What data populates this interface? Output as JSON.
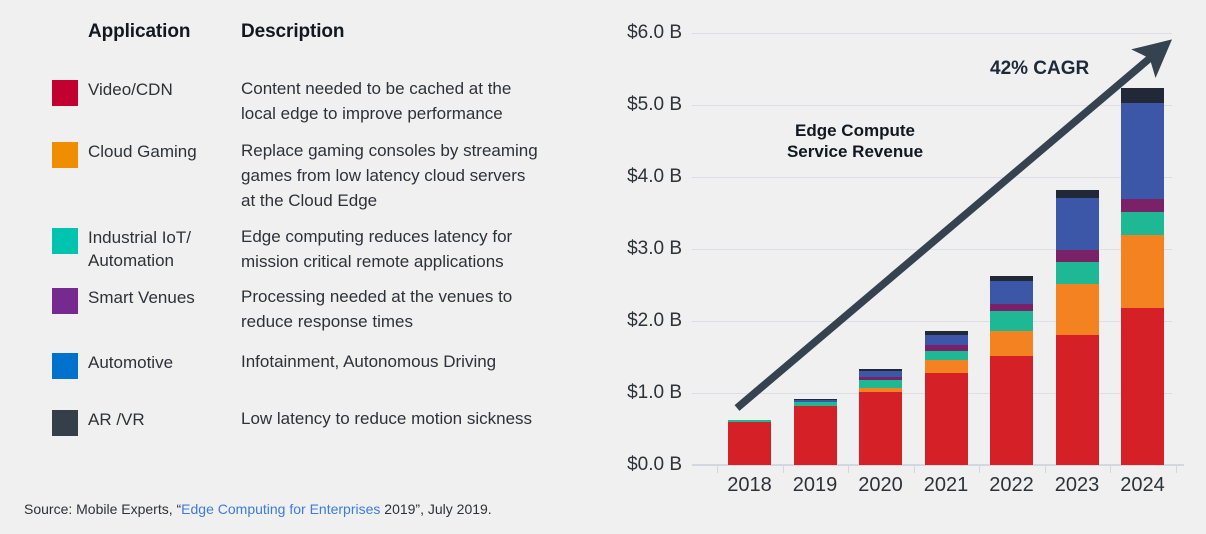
{
  "table": {
    "headers": {
      "application": "Application",
      "description": "Description"
    },
    "rows": [
      {
        "color": "#c10230",
        "application": "Video/CDN",
        "description": "Content needed to be cached at the\nlocal edge to improve performance"
      },
      {
        "color": "#ef8e00",
        "application": "Cloud Gaming",
        "description": "Replace gaming consoles by streaming\ngames from low latency cloud servers\nat the Cloud Edge"
      },
      {
        "color": "#00c4b0",
        "application": "Industrial IoT/\nAutomation",
        "description": "Edge computing reduces latency for\nmission critical remote applications"
      },
      {
        "color": "#762a8f",
        "application": "Smart Venues",
        "description": "Processing needed at the venues to\nreduce response times"
      },
      {
        "color": "#0072ce",
        "application": "Automotive",
        "description": "Infotainment, Autonomous Driving"
      },
      {
        "color": "#343f49",
        "application": "AR /VR",
        "description": "Low latency to reduce motion sickness"
      }
    ]
  },
  "source": {
    "prefix": "Source:  Mobile Experts, “",
    "link": "Edge Computing for Enterprises",
    "suffix": " 2019”, July 2019."
  },
  "chart_data": {
    "type": "bar",
    "stacked": true,
    "title": "Edge Compute\nService Revenue",
    "annotation": "42% CAGR",
    "xlabel": "",
    "ylabel": "",
    "categories": [
      "2018",
      "2019",
      "2020",
      "2021",
      "2022",
      "2023",
      "2024"
    ],
    "ytick_labels": [
      "$6.0 B",
      "$5.0 B",
      "$4.0 B",
      "$3.0 B",
      "$2.0 B",
      "$1.0 B",
      "$0.0 B"
    ],
    "ytick_values": [
      6.0,
      5.0,
      4.0,
      3.0,
      2.0,
      1.0,
      0.0
    ],
    "ylim": [
      0,
      6.0
    ],
    "grid": true,
    "legend_position": "external-table",
    "series": [
      {
        "name": "Video/CDN",
        "color": "#d62027",
        "values": [
          0.6,
          0.82,
          1.01,
          1.28,
          1.51,
          1.8,
          2.18
        ]
      },
      {
        "name": "Cloud Gaming",
        "color": "#f58220",
        "values": [
          0.0,
          0.0,
          0.06,
          0.18,
          0.35,
          0.72,
          1.02
        ]
      },
      {
        "name": "Industrial IoT/Automation",
        "color": "#1fb894",
        "values": [
          0.03,
          0.05,
          0.11,
          0.13,
          0.28,
          0.3,
          0.31
        ]
      },
      {
        "name": "Smart Venues",
        "color": "#7a2168",
        "values": [
          0.0,
          0.0,
          0.04,
          0.07,
          0.1,
          0.17,
          0.19
        ]
      },
      {
        "name": "Automotive",
        "color": "#3d57a8",
        "values": [
          0.0,
          0.03,
          0.09,
          0.15,
          0.32,
          0.72,
          1.33
        ]
      },
      {
        "name": "AR /VR",
        "color": "#232838",
        "values": [
          0.0,
          0.02,
          0.03,
          0.05,
          0.06,
          0.11,
          0.21
        ]
      }
    ],
    "totals": [
      0.63,
      0.92,
      1.34,
      1.86,
      2.62,
      3.82,
      5.24
    ]
  }
}
